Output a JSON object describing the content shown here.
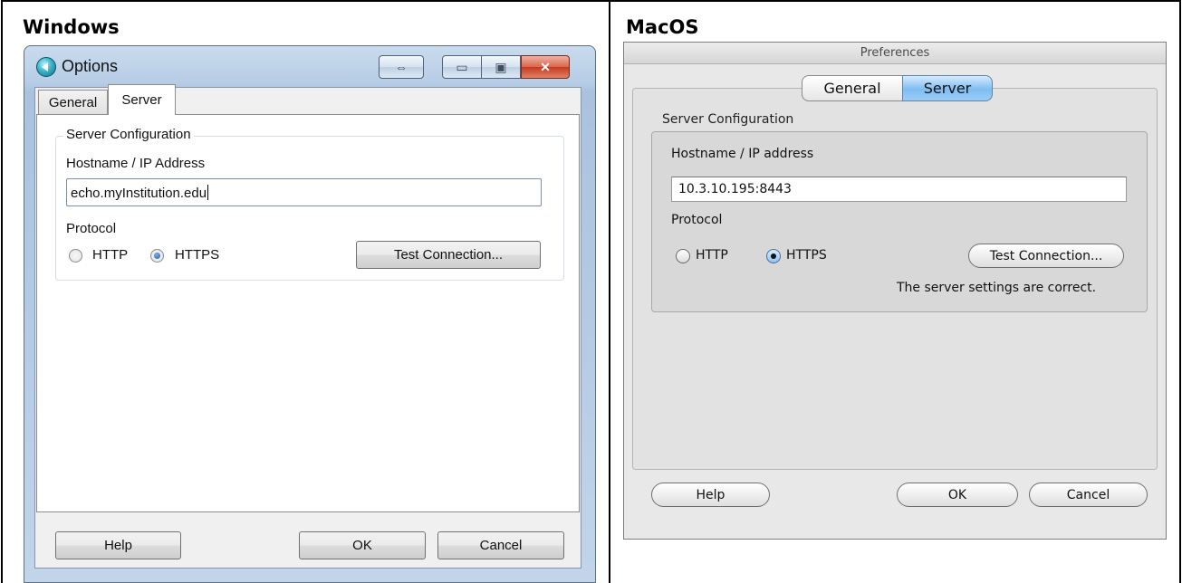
{
  "headings": {
    "windows": "Windows",
    "macos": "MacOS"
  },
  "windows_dialog": {
    "title": "Options",
    "title_buttons": {
      "resize_glyph": "⇔",
      "minimize_glyph": "▭",
      "maximize_glyph": "▣",
      "close_glyph": "✕"
    },
    "tabs": [
      {
        "label": "General",
        "active": false
      },
      {
        "label": "Server",
        "active": true
      }
    ],
    "group_label": "Server Configuration",
    "hostname_label": "Hostname / IP Address",
    "hostname_value": "echo.myInstitution.edu",
    "protocol_label": "Protocol",
    "protocol_options": [
      {
        "label": "HTTP",
        "selected": false
      },
      {
        "label": "HTTPS",
        "selected": true
      }
    ],
    "test_connection_label": "Test Connection...",
    "help_label": "Help",
    "ok_label": "OK",
    "cancel_label": "Cancel"
  },
  "mac_dialog": {
    "title": "Preferences",
    "tabs": [
      {
        "label": "General",
        "active": false
      },
      {
        "label": "Server",
        "active": true
      }
    ],
    "group_label": "Server Configuration",
    "hostname_label": "Hostname / IP address",
    "hostname_value": "10.3.10.195:8443",
    "protocol_label": "Protocol",
    "protocol_options": [
      {
        "label": "HTTP",
        "selected": false
      },
      {
        "label": "HTTPS",
        "selected": true
      }
    ],
    "test_connection_label": "Test Connection...",
    "status_message": "The server settings are correct.",
    "help_label": "Help",
    "ok_label": "OK",
    "cancel_label": "Cancel"
  },
  "colors": {
    "windows_frame": "#b7cde6",
    "mac_segment_active": "#7fbdf2",
    "windows_close": "#c63a1d"
  }
}
